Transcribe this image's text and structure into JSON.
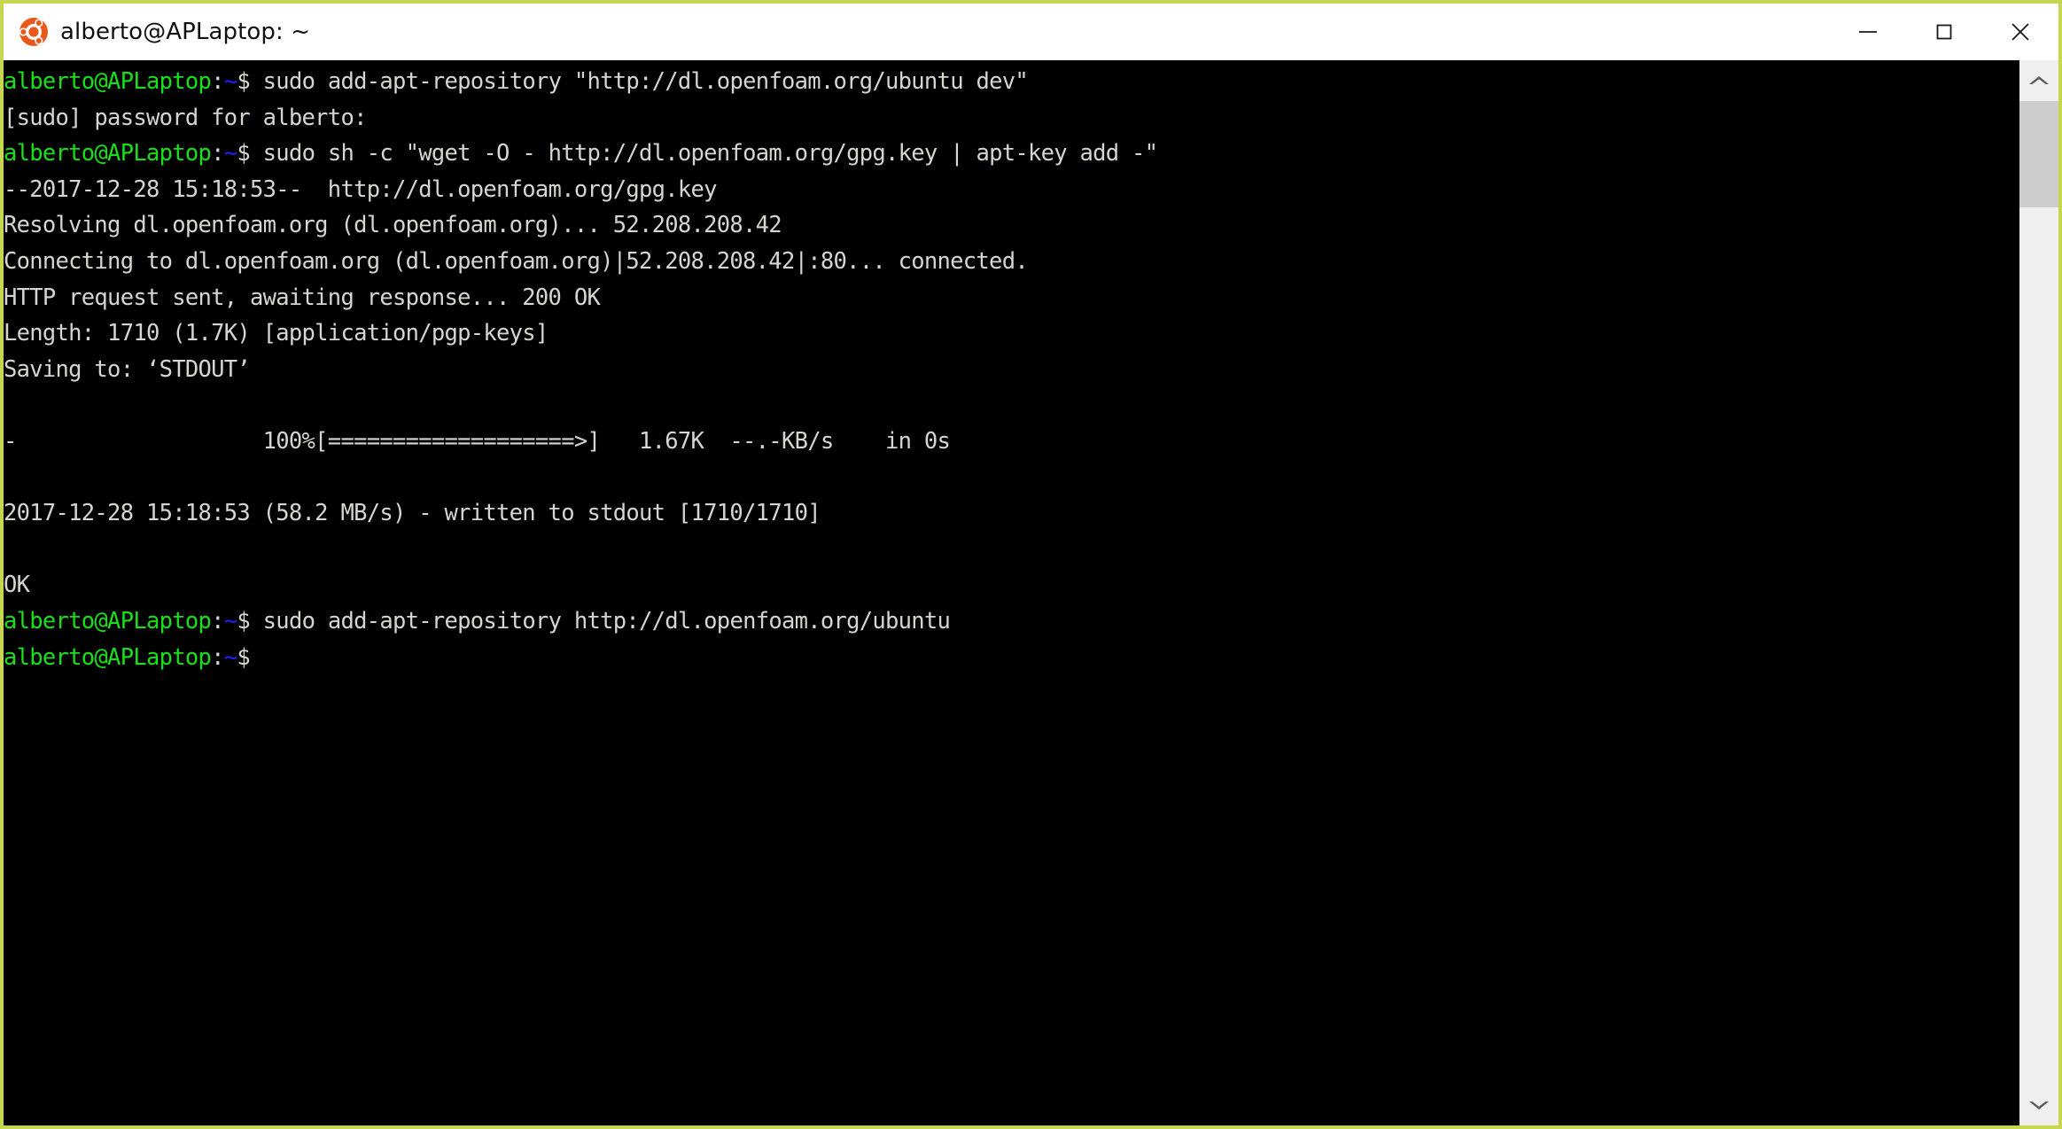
{
  "window": {
    "title": "alberto@APLaptop: ~",
    "icon": "ubuntu-logo-icon",
    "border_color": "#c6d64f",
    "titlebar_bg": "#ffffff",
    "controls": {
      "minimize_label": "—",
      "maximize_label": "❐",
      "close_label": "✕"
    }
  },
  "terminal": {
    "background": "#000000",
    "foreground": "#d3d7cf",
    "prompt_color": "#19e019",
    "path_color": "#2020ff",
    "prompt_user_host": "alberto@APLaptop",
    "prompt_colon": ":",
    "prompt_path": "~",
    "prompt_sigil": "$",
    "lines": [
      {
        "type": "prompt",
        "command": " sudo add-apt-repository \"http://dl.openfoam.org/ubuntu dev\""
      },
      {
        "type": "output",
        "text": "[sudo] password for alberto:"
      },
      {
        "type": "prompt",
        "command": " sudo sh -c \"wget -O - http://dl.openfoam.org/gpg.key | apt-key add -\""
      },
      {
        "type": "output",
        "text": "--2017-12-28 15:18:53--  http://dl.openfoam.org/gpg.key"
      },
      {
        "type": "output",
        "text": "Resolving dl.openfoam.org (dl.openfoam.org)... 52.208.208.42"
      },
      {
        "type": "output",
        "text": "Connecting to dl.openfoam.org (dl.openfoam.org)|52.208.208.42|:80... connected."
      },
      {
        "type": "output",
        "text": "HTTP request sent, awaiting response... 200 OK"
      },
      {
        "type": "output",
        "text": "Length: 1710 (1.7K) [application/pgp-keys]"
      },
      {
        "type": "output",
        "text": "Saving to: ‘STDOUT’"
      },
      {
        "type": "output",
        "text": ""
      },
      {
        "type": "output",
        "text": "-                   100%[===================>]   1.67K  --.-KB/s    in 0s"
      },
      {
        "type": "output",
        "text": ""
      },
      {
        "type": "output",
        "text": "2017-12-28 15:18:53 (58.2 MB/s) - written to stdout [1710/1710]"
      },
      {
        "type": "output",
        "text": ""
      },
      {
        "type": "output",
        "text": "OK"
      },
      {
        "type": "prompt",
        "command": " sudo add-apt-repository http://dl.openfoam.org/ubuntu"
      },
      {
        "type": "prompt",
        "command": ""
      }
    ],
    "progress": {
      "percent": "100%",
      "size": "1.67K",
      "rate": "--.-KB/s",
      "elapsed": "in 0s"
    }
  },
  "scrollbar": {
    "up_arrow": "chevron-up-icon",
    "down_arrow": "chevron-down-icon",
    "track_color": "#efefef",
    "thumb_color": "#cdcdcd"
  }
}
